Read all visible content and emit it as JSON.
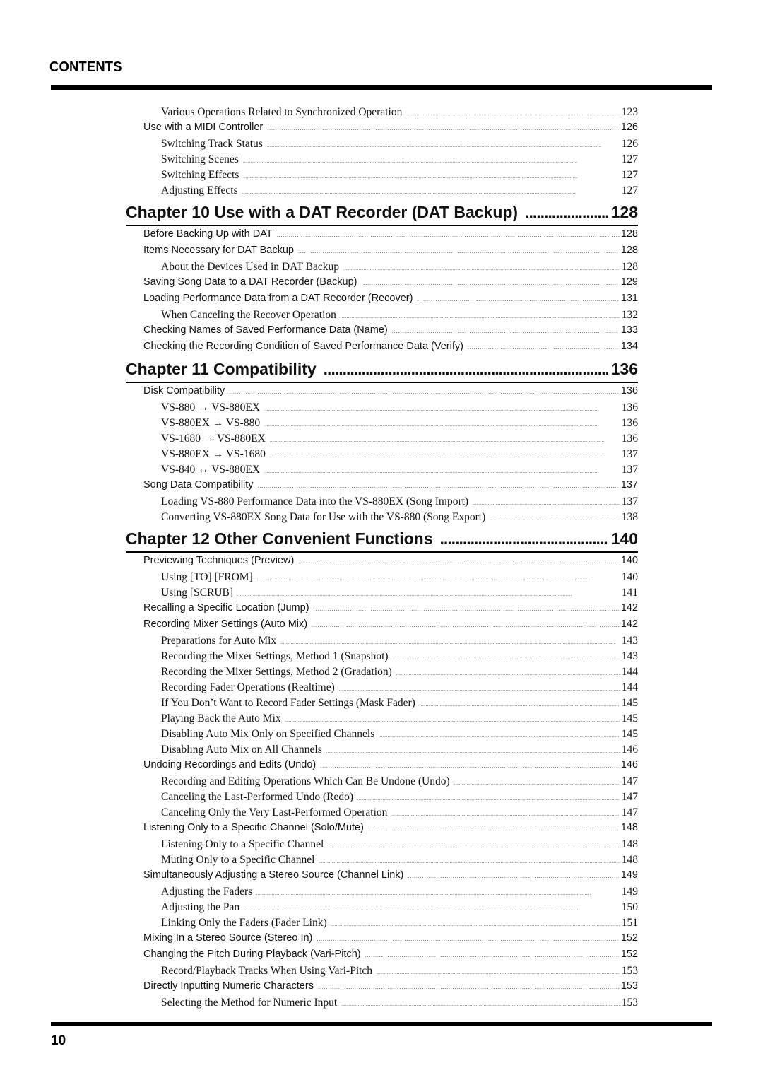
{
  "header": {
    "title": "CONTENTS"
  },
  "footer": {
    "page_number": "10"
  },
  "toc": {
    "pre_entries": [
      {
        "level": 2,
        "label": "Various Operations Related to Synchronized Operation",
        "page": "123"
      },
      {
        "level": 1,
        "label": "Use with a MIDI Controller",
        "page": "126"
      },
      {
        "level": 2,
        "label": "Switching Track Status",
        "page": "126"
      },
      {
        "level": 2,
        "label": "Switching Scenes",
        "page": "127"
      },
      {
        "level": 2,
        "label": "Switching Effects",
        "page": "127"
      },
      {
        "level": 2,
        "label": "Adjusting Effects",
        "page": "127"
      }
    ],
    "chapters": [
      {
        "title": "Chapter 10 Use with a DAT Recorder (DAT Backup)",
        "page": "128",
        "entries": [
          {
            "level": 1,
            "label": "Before Backing Up with DAT",
            "page": "128"
          },
          {
            "level": 1,
            "label": "Items Necessary for DAT Backup",
            "page": "128"
          },
          {
            "level": 2,
            "label": "About the Devices Used in DAT Backup",
            "page": "128"
          },
          {
            "level": 1,
            "label": "Saving Song Data to a DAT Recorder (Backup)",
            "page": "129"
          },
          {
            "level": 1,
            "label": "Loading Performance Data from a DAT Recorder (Recover)",
            "page": "131"
          },
          {
            "level": 2,
            "label": "When Canceling the Recover Operation",
            "page": "132"
          },
          {
            "level": 1,
            "label": "Checking Names of Saved Performance Data (Name)",
            "page": "133"
          },
          {
            "level": 1,
            "label": "Checking the Recording Condition of Saved Performance Data (Verify)",
            "page": "134"
          }
        ]
      },
      {
        "title": "Chapter 11 Compatibility",
        "page": "136",
        "entries": [
          {
            "level": 1,
            "label": "Disk Compatibility",
            "page": "136"
          },
          {
            "level": 2,
            "label": "VS-880 → VS-880EX",
            "page": "136"
          },
          {
            "level": 2,
            "label": "VS-880EX → VS-880",
            "page": "136"
          },
          {
            "level": 2,
            "label": "VS-1680 → VS-880EX",
            "page": "136"
          },
          {
            "level": 2,
            "label": "VS-880EX → VS-1680",
            "page": "137"
          },
          {
            "level": 2,
            "label": "VS-840 ↔ VS-880EX",
            "page": "137"
          },
          {
            "level": 1,
            "label": "Song Data Compatibility",
            "page": "137"
          },
          {
            "level": 2,
            "label": "Loading VS-880 Performance Data into the VS-880EX (Song Import)",
            "page": "137"
          },
          {
            "level": 2,
            "label": "Converting VS-880EX Song Data for Use with the VS-880 (Song Export)",
            "page": "138"
          }
        ]
      },
      {
        "title": "Chapter 12 Other Convenient Functions",
        "page": "140",
        "entries": [
          {
            "level": 1,
            "label": "Previewing Techniques (Preview)",
            "page": "140"
          },
          {
            "level": 2,
            "label": "Using [TO] [FROM]",
            "page": "140"
          },
          {
            "level": 2,
            "label": "Using [SCRUB]",
            "page": "141"
          },
          {
            "level": 1,
            "label": "Recalling a Specific Location (Jump)",
            "page": "142"
          },
          {
            "level": 1,
            "label": "Recording Mixer Settings (Auto Mix)",
            "page": "142"
          },
          {
            "level": 2,
            "label": "Preparations for Auto Mix",
            "page": "143"
          },
          {
            "level": 2,
            "label": "Recording the Mixer Settings, Method 1 (Snapshot)",
            "page": "143"
          },
          {
            "level": 2,
            "label": "Recording the Mixer Settings, Method 2 (Gradation)",
            "page": "144"
          },
          {
            "level": 2,
            "label": "Recording Fader Operations (Realtime)",
            "page": "144"
          },
          {
            "level": 2,
            "label": "If You Don’t Want to Record Fader Settings (Mask Fader)",
            "page": "145"
          },
          {
            "level": 2,
            "label": "Playing Back the Auto Mix",
            "page": "145"
          },
          {
            "level": 2,
            "label": "Disabling Auto Mix Only on Specified Channels",
            "page": "145"
          },
          {
            "level": 2,
            "label": "Disabling Auto Mix on All Channels",
            "page": "146"
          },
          {
            "level": 1,
            "label": "Undoing Recordings and Edits (Undo)",
            "page": "146"
          },
          {
            "level": 2,
            "label": "Recording and Editing Operations Which Can Be Undone (Undo)",
            "page": "147"
          },
          {
            "level": 2,
            "label": "Canceling the Last-Performed Undo (Redo)",
            "page": "147"
          },
          {
            "level": 2,
            "label": "Canceling Only the Very Last-Performed Operation",
            "page": "147"
          },
          {
            "level": 1,
            "label": "Listening Only to a Specific Channel (Solo/Mute)",
            "page": "148"
          },
          {
            "level": 2,
            "label": "Listening Only to a Specific Channel",
            "page": "148"
          },
          {
            "level": 2,
            "label": "Muting Only to a Specific Channel",
            "page": "148"
          },
          {
            "level": 1,
            "label": "Simultaneously Adjusting a Stereo Source (Channel Link)",
            "page": "149"
          },
          {
            "level": 2,
            "label": "Adjusting the Faders",
            "page": "149"
          },
          {
            "level": 2,
            "label": "Adjusting the Pan",
            "page": "150"
          },
          {
            "level": 2,
            "label": "Linking Only the Faders (Fader Link)",
            "page": "151"
          },
          {
            "level": 1,
            "label": "Mixing In a Stereo Source (Stereo In)",
            "page": "152"
          },
          {
            "level": 1,
            "label": "Changing the Pitch During Playback (Vari-Pitch)",
            "page": "152"
          },
          {
            "level": 2,
            "label": "Record/Playback Tracks When Using Vari-Pitch",
            "page": "153"
          },
          {
            "level": 1,
            "label": "Directly Inputting Numeric Characters",
            "page": "153"
          },
          {
            "level": 2,
            "label": "Selecting the Method for Numeric Input",
            "page": "153"
          }
        ]
      }
    ]
  }
}
